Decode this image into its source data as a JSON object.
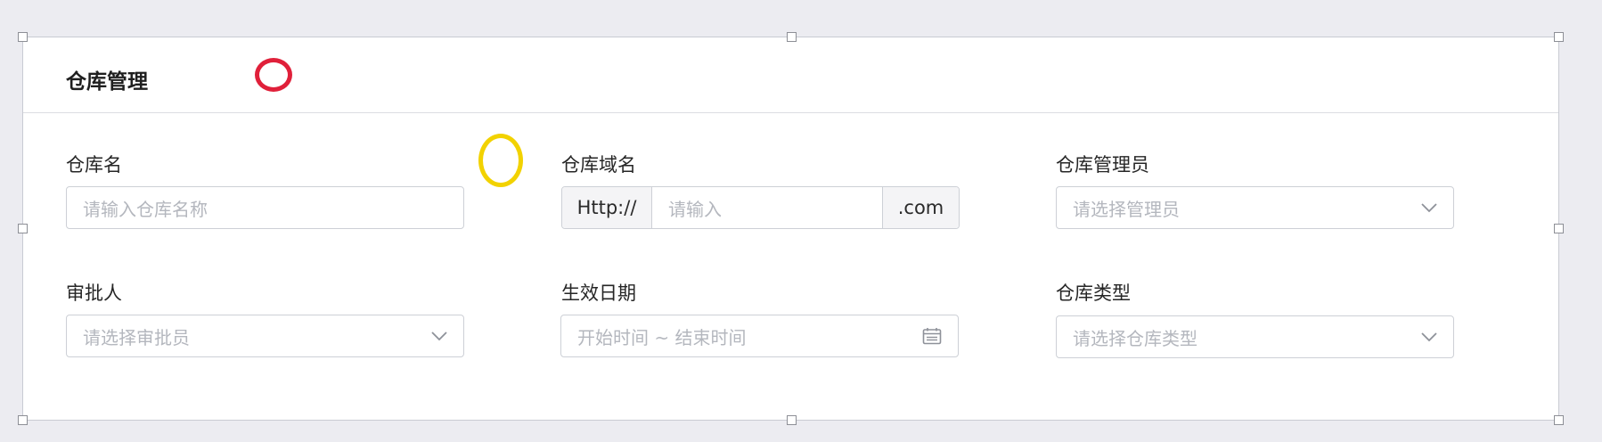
{
  "card": {
    "title": "仓库管理"
  },
  "fields": {
    "warehouse_name": {
      "label": "仓库名",
      "placeholder": "请输入仓库名称"
    },
    "warehouse_domain": {
      "label": "仓库域名",
      "prefix": "Http://",
      "placeholder": "请输入",
      "suffix": ".com"
    },
    "warehouse_admin": {
      "label": "仓库管理员",
      "placeholder": "请选择管理员"
    },
    "approver": {
      "label": "审批人",
      "placeholder": "请选择审批员"
    },
    "effective_date": {
      "label": "生效日期",
      "placeholder": "开始时间 ~ 结束时间"
    },
    "warehouse_type": {
      "label": "仓库类型",
      "placeholder": "请选择仓库类型"
    }
  },
  "icons": {
    "select_arrow": "chevron-down-icon",
    "date": "calendar-icon"
  },
  "colors": {
    "annotation_red": "#e0203a",
    "annotation_yellow": "#f2d200",
    "page_background": "#ececf1",
    "border": "#cdd0d6",
    "placeholder_text": "#b4b7be"
  }
}
